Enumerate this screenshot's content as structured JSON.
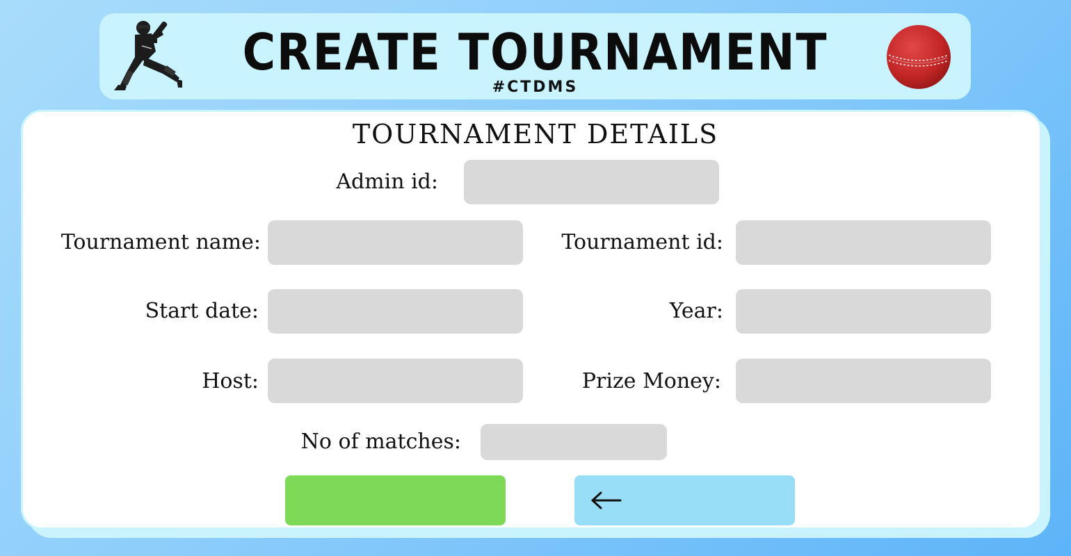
{
  "header": {
    "title": "CREATE TOURNAMENT",
    "subtitle": "#CTDMS",
    "left_icon": "batsman-icon",
    "right_icon": "cricket-ball-icon"
  },
  "form": {
    "title": "TOURNAMENT DETAILS",
    "fields": {
      "admin_id": {
        "label": "Admin id:",
        "value": "",
        "placeholder": ""
      },
      "tournament_name": {
        "label": "Tournament name:",
        "value": "",
        "placeholder": ""
      },
      "tournament_id": {
        "label": "Tournament id:",
        "value": "",
        "placeholder": ""
      },
      "start_date": {
        "label": "Start date:",
        "value": "",
        "placeholder": ""
      },
      "year": {
        "label": "Year:",
        "value": "",
        "placeholder": ""
      },
      "host": {
        "label": "Host:",
        "value": "",
        "placeholder": ""
      },
      "prize_money": {
        "label": "Prize Money:",
        "value": "",
        "placeholder": ""
      },
      "no_of_matches": {
        "label": "No of matches:",
        "value": "",
        "placeholder": ""
      }
    },
    "buttons": {
      "submit_label": "",
      "back_icon": "arrow-left-icon"
    }
  },
  "colors": {
    "header_bg": "#c9f4ff",
    "field_bg": "#d9d9d9",
    "submit_green": "#7ed957",
    "back_blue": "#97def6",
    "ball_red": "#cc2a2a"
  }
}
